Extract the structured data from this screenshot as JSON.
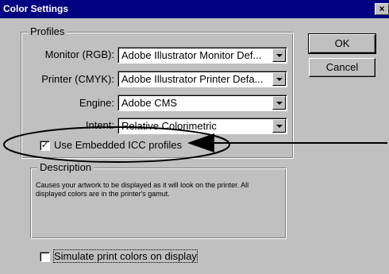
{
  "window": {
    "title": "Color Settings",
    "close_glyph": "×"
  },
  "profiles": {
    "legend": "Profiles",
    "monitor": {
      "label": "Monitor (RGB):",
      "value": "Adobe Illustrator Monitor Def..."
    },
    "printer": {
      "label": "Printer (CMYK):",
      "value": "Adobe Illustrator Printer Defa..."
    },
    "engine": {
      "label": "Engine:",
      "value": "Adobe CMS"
    },
    "intent": {
      "label": "Intent:",
      "value": "Relative Colorimetric"
    },
    "use_embedded": {
      "label": "Use Embedded ICC profiles",
      "checked": true,
      "check_glyph": "✓"
    }
  },
  "buttons": {
    "ok": "OK",
    "cancel": "Cancel"
  },
  "description": {
    "legend": "Description",
    "text": "Causes your artwork to be displayed as it will look on the printer. All displayed colors are in the printer's gamut."
  },
  "simulate": {
    "label": "Simulate print colors on display",
    "checked": false
  },
  "annotation": {
    "color": "#000000",
    "shape": "ellipse-with-arrow"
  },
  "colors": {
    "titlebar": "#000080",
    "dialog_bg": "#c0c0c0"
  }
}
